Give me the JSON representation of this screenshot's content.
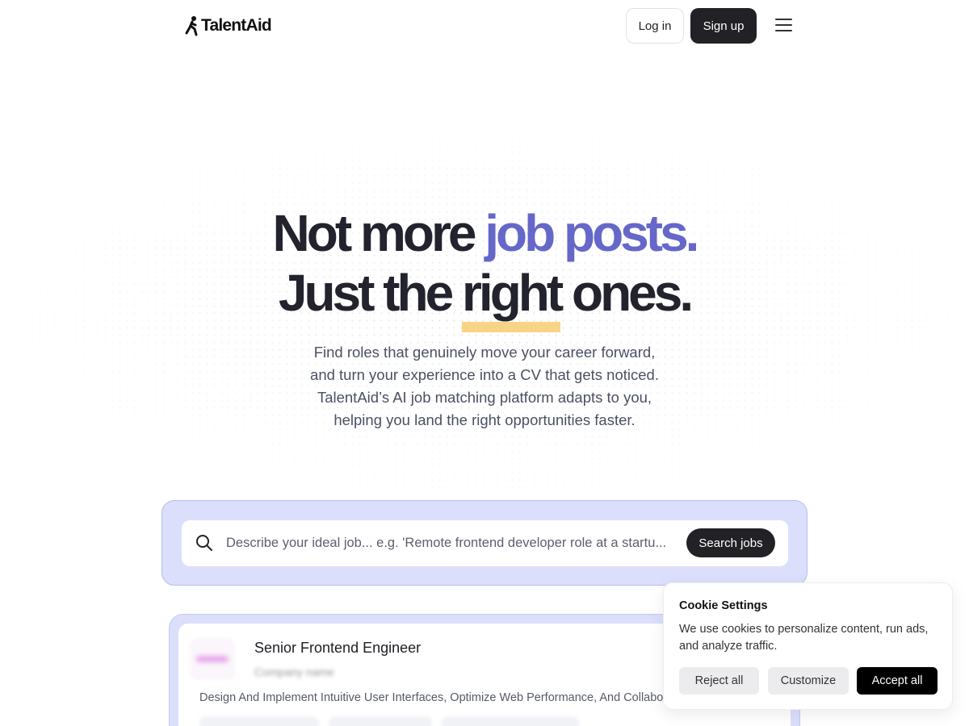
{
  "header": {
    "logo_text": "TalentAid",
    "login_label": "Log in",
    "signup_label": "Sign up"
  },
  "hero": {
    "line1_plain": "Not more ",
    "line1_accent": "job posts.",
    "line2_before": "Just the ",
    "line2_underlined": "right",
    "line2_after": " ones.",
    "subtitle_lines": [
      "Find roles that genuinely move your career forward,",
      "and turn your experience into a CV that gets noticed.",
      "TalentAid’s AI job matching platform adapts to you,",
      "helping you land the right opportunities faster."
    ]
  },
  "search": {
    "placeholder": "Describe your ideal job... e.g. 'Remote frontend developer role at a startu...",
    "button_label": "Search jobs"
  },
  "job_card": {
    "title": "Senior Frontend Engineer",
    "company": "Company name",
    "description": "Design And Implement Intuitive User Interfaces, Optimize Web Performance, And Collaborate"
  },
  "cookie": {
    "title": "Cookie Settings",
    "text": "We use cookies to personalize content, run ads, and analyze traffic.",
    "reject_label": "Reject all",
    "customize_label": "Customize",
    "accept_label": "Accept all"
  },
  "colors": {
    "accent": "#6567c9",
    "highlight": "#f8d483",
    "search_bg": "#dcdffb",
    "dark_button": "#222226"
  }
}
